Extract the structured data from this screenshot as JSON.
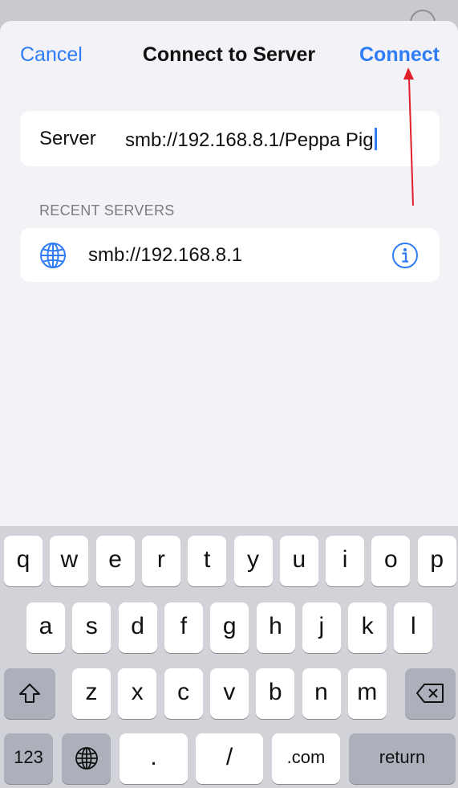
{
  "nav": {
    "cancel_label": "Cancel",
    "title": "Connect to Server",
    "connect_label": "Connect"
  },
  "server_field": {
    "label": "Server",
    "value": "smb://192.168.8.1/Peppa Pig"
  },
  "recent": {
    "header": "RECENT SERVERS",
    "items": [
      {
        "address": "smb://192.168.8.1",
        "icon": "globe-icon",
        "action_icon": "info-icon"
      }
    ]
  },
  "keyboard": {
    "row1": [
      "q",
      "w",
      "e",
      "r",
      "t",
      "y",
      "u",
      "i",
      "o",
      "p"
    ],
    "row2": [
      "a",
      "s",
      "d",
      "f",
      "g",
      "h",
      "j",
      "k",
      "l"
    ],
    "row3": [
      "z",
      "x",
      "c",
      "v",
      "b",
      "n",
      "m"
    ],
    "shift_icon": "shift-icon",
    "delete_icon": "delete-icon",
    "numbers_label": "123",
    "globe_icon": "globe-icon",
    "dot_label": ".",
    "slash_label": "/",
    "dotcom_label": ".com",
    "return_label": "return"
  },
  "colors": {
    "accent": "#2f7cf6",
    "annotation_arrow": "#e0202a",
    "sheet_background": "#f2f2f7",
    "keyboard_background": "#d1d3d9"
  }
}
